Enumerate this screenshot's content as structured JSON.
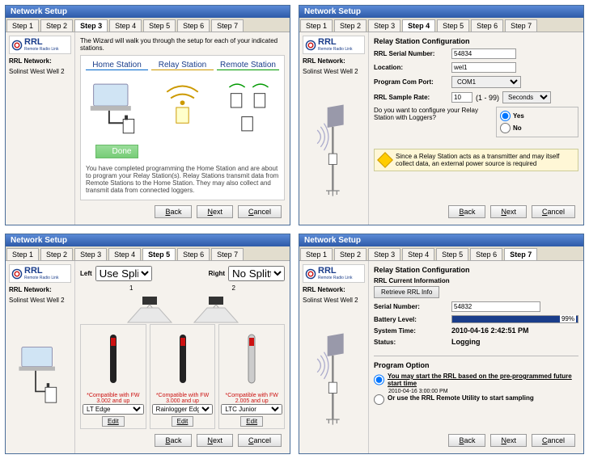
{
  "common": {
    "title": "Network Setup",
    "steps": [
      "Step 1",
      "Step 2",
      "Step 3",
      "Step 4",
      "Step 5",
      "Step 6",
      "Step 7"
    ],
    "logo_text": "RRL",
    "logo_sub": "Remote Radio Link",
    "side_head": "RRL Network:",
    "side_name": "Solinst West Well 2",
    "btn_back": "Back",
    "btn_next": "Next",
    "btn_cancel": "Cancel"
  },
  "dlg1": {
    "active_step": 2,
    "intro": "The Wizard will walk you through the setup for each of your indicated stations.",
    "cols": {
      "home": "Home Station",
      "relay": "Relay Station",
      "remote": "Remote Station"
    },
    "done": "Done",
    "desc": "You have completed programming the Home Station and are about to program your Relay Station(s). Relay Stations transmit data from Remote Stations to the Home Station. They may also collect and transmit data from connected loggers."
  },
  "dlg2": {
    "active_step": 3,
    "group_title": "Relay Station Configuration",
    "fields": {
      "serial_lbl": "RRL Serial Number:",
      "serial_val": "54834",
      "loc_lbl": "Location:",
      "loc_val": "wel1",
      "com_lbl": "Program Com Port:",
      "com_val": "COM1",
      "rate_lbl": "RRL Sample Rate:",
      "rate_val": "10",
      "rate_range": "(1 - 99)",
      "rate_unit": "Seconds"
    },
    "cfg_q": "Do you want to configure your Relay Station with Loggers?",
    "yes": "Yes",
    "no": "No",
    "warn": "Since a Relay Station acts as a transmitter and may itself collect data, an external power source is required"
  },
  "dlg3": {
    "active_step": 4,
    "left_lbl": "Left",
    "right_lbl": "Right",
    "left_sel": "Use Splitter",
    "right_sel": "No Splitter",
    "left_n": "1",
    "right_n": "2",
    "compat1": "*Compatible with FW 3.002 and up",
    "compat2": "*Compatible with FW 3.000 and up",
    "compat3": "*Compatible with FW 2.005 and up",
    "log1": "LT Edge",
    "log2": "Rainlogger Edge",
    "log3": "LTC Junior",
    "edit": "Edit"
  },
  "dlg4": {
    "active_step": 6,
    "group_title": "Relay Station Configuration",
    "sub_title": "RRL Current Information",
    "retrieve": "Retrieve RRL Info",
    "serial_lbl": "Serial Number:",
    "serial_val": "54832",
    "batt_lbl": "Battery Level:",
    "batt_val": "99%",
    "time_lbl": "System Time:",
    "time_val": "2010-04-16 2:42:51 PM",
    "status_lbl": "Status:",
    "status_val": "Logging",
    "prog_title": "Program Option",
    "opt1": "You may start the RRL based on the pre-programmed future start time",
    "opt1_sub": "2010-04-16    3:00:00 PM",
    "opt2": "Or use the RRL Remote Utility to start sampling"
  }
}
